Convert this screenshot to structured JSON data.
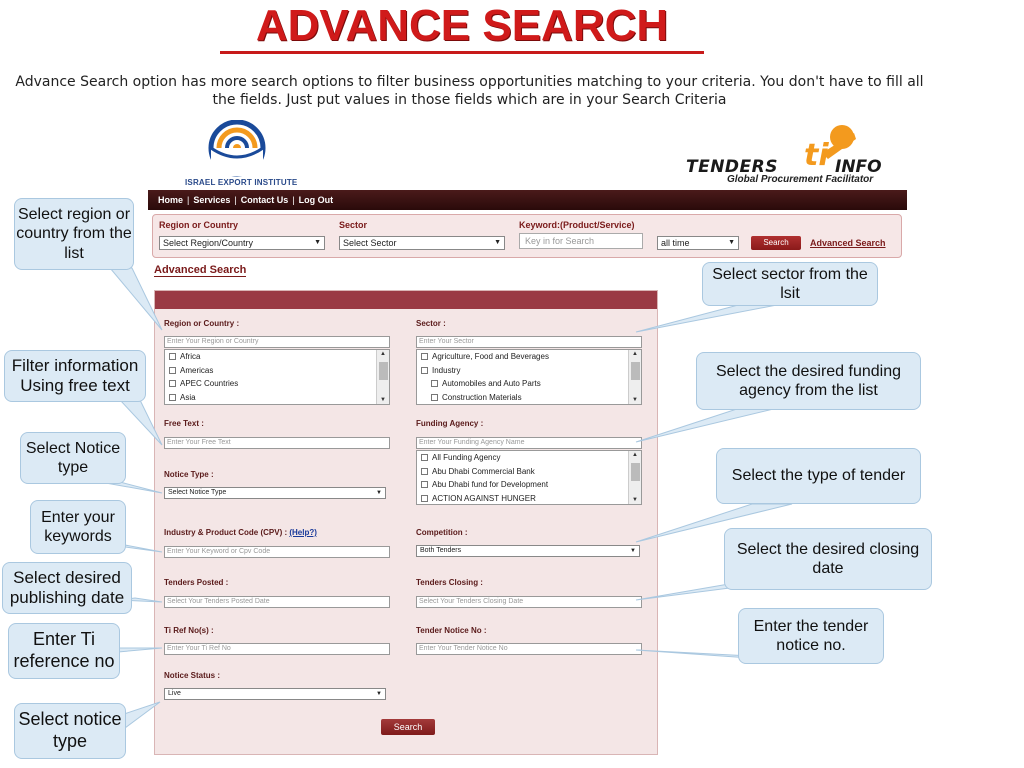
{
  "slide": {
    "title": "ADVANCE SEARCH",
    "intro": "Advance Search option has more search options to filter business opportunities matching to your criteria. You don't have to fill all the fields. Just put values in those fields which are in your Search Criteria"
  },
  "logos": {
    "iei_text": "ISRAEL EXPORT INSTITUTE",
    "ti_name_part1": "TENDERS",
    "ti_name_part2": "INFO",
    "ti_tagline": "Global Procurement Facilitator"
  },
  "nav": {
    "items": [
      "Home",
      "Services",
      "Contact Us",
      "Log Out"
    ],
    "separator": "|"
  },
  "quick_search": {
    "region_label": "Region or Country",
    "region_value": "Select Region/Country",
    "sector_label": "Sector",
    "sector_value": "Select Sector",
    "keyword_label": "Keyword:(Product/Service)",
    "keyword_placeholder": "Key in for Search",
    "time_value": "all time",
    "search_button": "Search",
    "advanced_link": "Advanced Search"
  },
  "advanced": {
    "heading": "Advanced Search",
    "region_label": "Region or Country :",
    "region_placeholder": "Enter Your Region or Country",
    "region_options": [
      "Africa",
      "Americas",
      "APEC Countries",
      "Asia"
    ],
    "sector_label": "Sector :",
    "sector_placeholder": "Enter Your Sector",
    "sector_options": [
      "Agriculture, Food and Beverages",
      "Industry",
      "Automobiles and Auto Parts",
      "Construction Materials"
    ],
    "free_text_label": "Free Text :",
    "free_text_placeholder": "Enter Your Free Text",
    "funding_label": "Funding Agency :",
    "funding_placeholder": "Enter Your Funding Agency Name",
    "funding_options": [
      "All Funding Agency",
      "Abu Dhabi Commercial Bank",
      "Abu Dhabi fund for Development",
      "ACTION AGAINST HUNGER"
    ],
    "notice_type_label": "Notice Type :",
    "notice_type_value": "Select Notice Type",
    "cpv_label": "Industry & Product Code (CPV) :",
    "cpv_help": "(Help?)",
    "cpv_placeholder": "Enter Your Keyword or Cpv Code",
    "competition_label": "Competition :",
    "competition_value": "Both Tenders",
    "posted_label": "Tenders Posted :",
    "posted_placeholder": "Select Your Tenders Posted Date",
    "closing_label": "Tenders Closing :",
    "closing_placeholder": "Select Your Tenders Closing Date",
    "tiref_label": "Ti Ref No(s) :",
    "tiref_placeholder": "Enter Your Ti Ref No",
    "notice_no_label": "Tender Notice No :",
    "notice_no_placeholder": "Enter Your Tender Notice No",
    "status_label": "Notice Status :",
    "status_value": "Live",
    "search_button": "Search"
  },
  "callouts": {
    "region": "Select region or country from the list",
    "free_text": "Filter information Using free text",
    "notice_type": "Select Notice type",
    "keywords": "Enter your keywords",
    "publishing": "Select desired publishing date",
    "ti_ref": "Enter Ti reference no",
    "notice_status": "Select notice type",
    "sector": "Select sector from the lsit",
    "funding": "Select the desired funding agency from the list",
    "tender_type": "Select the type of tender",
    "closing": "Select the desired closing date",
    "notice_no": "Enter the tender notice no."
  },
  "colors": {
    "title_red": "#d01a1a",
    "nav_dark": "#2a0a0a",
    "panel_pink": "#f4e6e6",
    "panel_header": "#9a3a44",
    "callout_blue": "#dceaf5",
    "ti_orange": "#f39a1e"
  }
}
